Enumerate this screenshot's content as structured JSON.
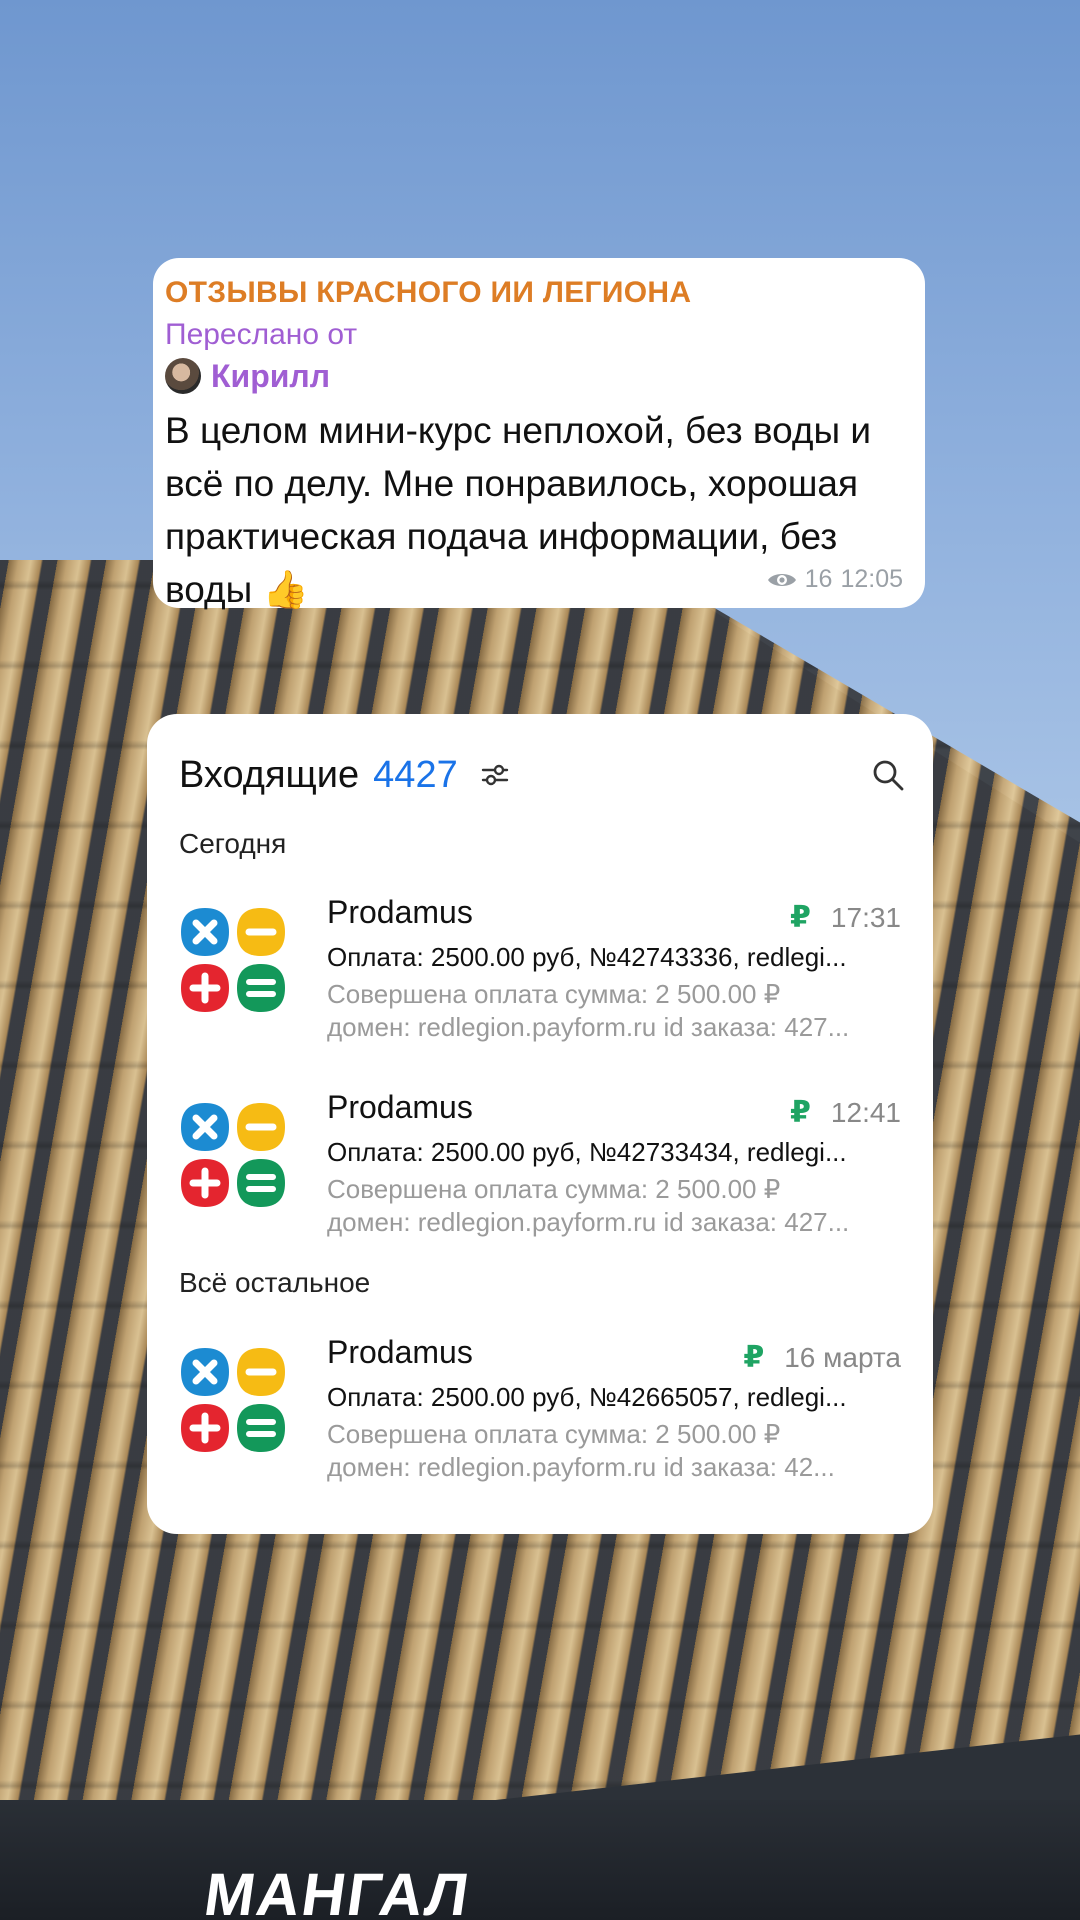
{
  "message": {
    "channel": "ОТЗЫВЫ КРАСНОГО ИИ ЛЕГИОНА",
    "forwarded_label": "Переслано от",
    "author": "Кирилл",
    "text": "В целом мини-курс неплохой, без воды и всё по делу. Мне понравилось, хорошая практическая подача информации, без воды 👍",
    "views": "16",
    "time": "12:05"
  },
  "mail": {
    "title": "Входящие",
    "count": "4427",
    "sections": {
      "today": "Сегодня",
      "other": "Всё остальное"
    },
    "items": [
      {
        "sender": "Prodamus",
        "time": "17:31",
        "subject": "Оплата: 2500.00 руб, №42743336, redlegi...",
        "preview_line1": "Совершена оплата сумма: 2 500.00 ₽",
        "preview_line2": "домен: redlegion.payform.ru id заказа: 427..."
      },
      {
        "sender": "Prodamus",
        "time": "12:41",
        "subject": "Оплата: 2500.00 руб, №42733434, redlegi...",
        "preview_line1": "Совершена оплата сумма: 2 500.00 ₽",
        "preview_line2": "домен: redlegion.payform.ru id заказа: 427..."
      },
      {
        "sender": "Prodamus",
        "time": "16 марта",
        "subject": "Оплата: 2500.00 руб, №42665057, redlegi...",
        "preview_line1": "Совершена оплата сумма: 2 500.00 ₽",
        "preview_line2": "домен: redlegion.payform.ru id заказа: 42..."
      }
    ],
    "ruble_icon": "₽"
  },
  "background": {
    "sign_text": "МАНГАЛ"
  },
  "colors": {
    "channel": "#dd7d25",
    "forwarded": "#a05ed3",
    "count": "#1a73e8",
    "ruble": "#1fa463"
  }
}
